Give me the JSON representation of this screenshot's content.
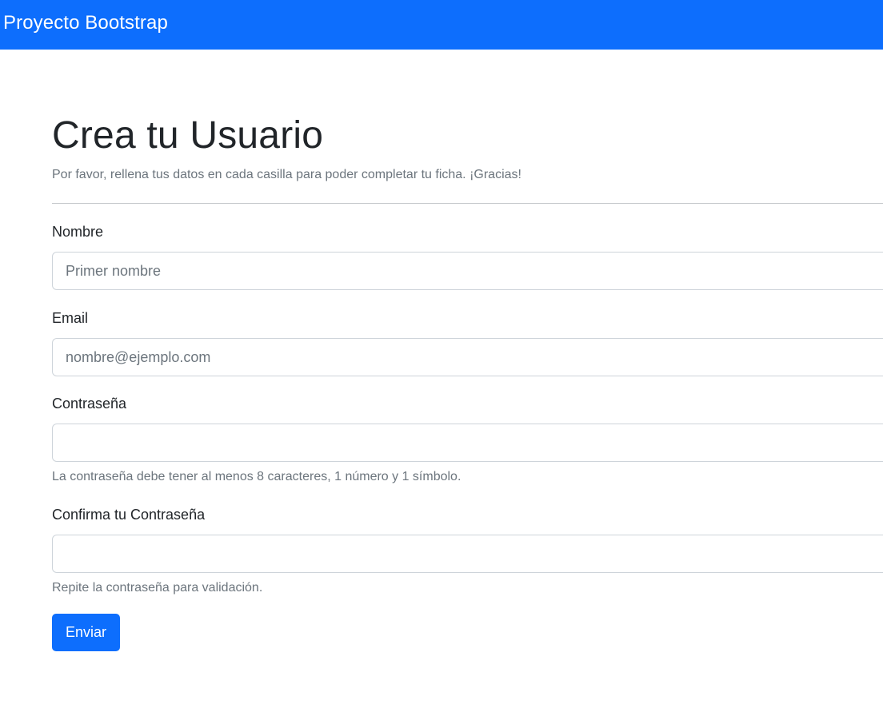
{
  "navbar": {
    "brand": "Proyecto Bootstrap"
  },
  "page": {
    "title": "Crea tu Usuario",
    "lead": "Por favor, rellena tus datos en cada casilla para poder completar tu ficha. ¡Gracias!"
  },
  "form": {
    "nombre": {
      "label": "Nombre",
      "placeholder": "Primer nombre",
      "value": ""
    },
    "email": {
      "label": "Email",
      "placeholder": "nombre@ejemplo.com",
      "value": ""
    },
    "password": {
      "label": "Contraseña",
      "placeholder": "",
      "value": "",
      "help": "La contraseña debe tener al menos 8 caracteres, 1 número y 1 símbolo."
    },
    "confirm": {
      "label": "Confirma tu Contraseña",
      "placeholder": "",
      "value": "",
      "help": "Repite la contraseña para validación."
    },
    "submit_label": "Enviar"
  },
  "colors": {
    "primary": "#0d6efd",
    "muted": "#6c757d",
    "text": "#212529"
  }
}
